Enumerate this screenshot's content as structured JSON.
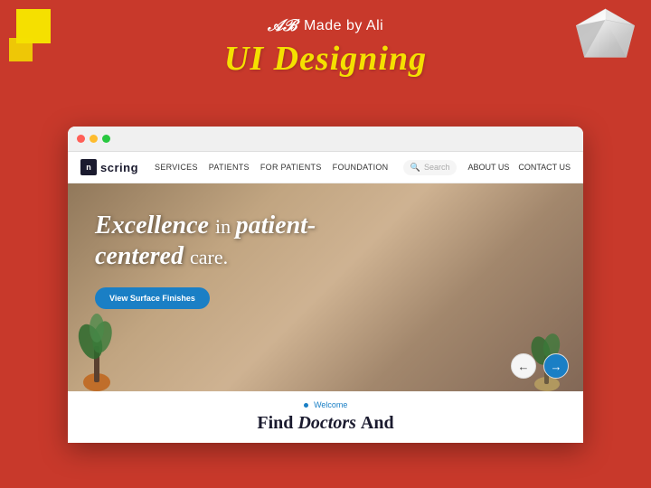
{
  "header": {
    "made_by": "Made by Ali",
    "title": "UI Designing"
  },
  "browser": {
    "dots": [
      "red",
      "yellow",
      "green"
    ]
  },
  "website": {
    "logo": {
      "icon": "n",
      "name": "scring"
    },
    "nav": {
      "links": [
        "SERVICES",
        "PATIENTS",
        "FOR PATIENTS",
        "FOUNDATION"
      ],
      "right_links": [
        "ABOUT US",
        "CONTACT US"
      ],
      "search_placeholder": "Search"
    },
    "hero": {
      "title_line1": "Excellence",
      "title_in": "in",
      "title_patient": "patient-",
      "title_centered": "centered",
      "title_care": "care.",
      "cta_button": "View Surface Finishes"
    },
    "below_hero": {
      "welcome_label": "Welcome",
      "find_title_1": "Find",
      "find_title_italic": "Doctors",
      "find_title_2": "And"
    },
    "arrows": {
      "prev": "←",
      "next": "→"
    }
  }
}
